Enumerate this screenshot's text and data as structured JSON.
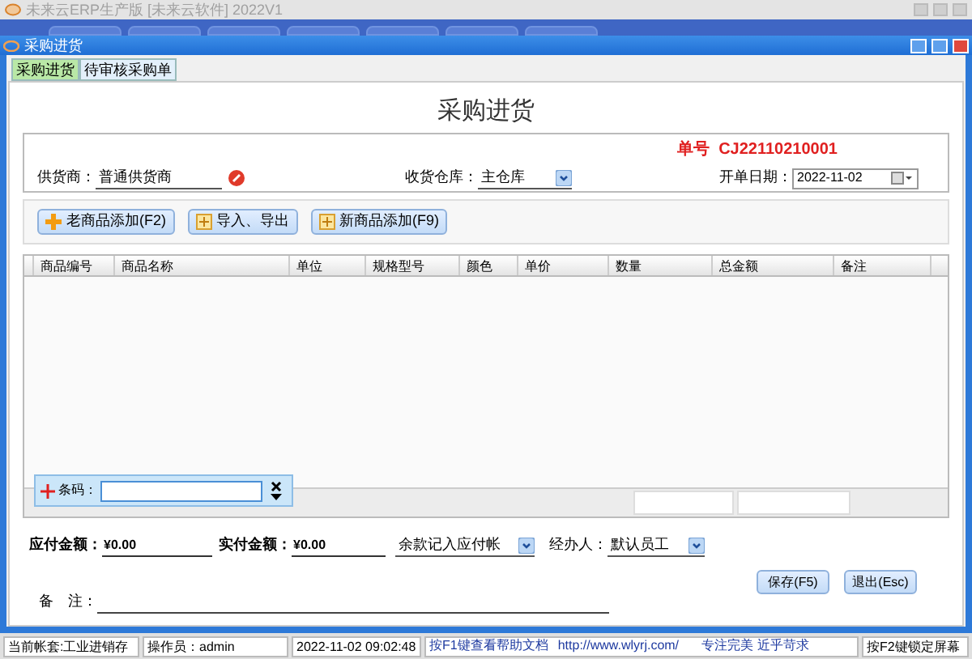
{
  "app_title": "未来云ERP生产版 [未来云软件] 2022V1",
  "window": {
    "title": "采购进货"
  },
  "tabs": [
    {
      "label": "采购进货",
      "selected": true
    },
    {
      "label": "待审核采购单",
      "selected": false
    }
  ],
  "form_title": "采购进货",
  "order_no": {
    "label": "单号",
    "value": "CJ22110210001"
  },
  "supplier": {
    "label": "供货商：",
    "value": "普通供货商"
  },
  "warehouse": {
    "label": "收货仓库：",
    "value": "主仓库"
  },
  "date": {
    "label": "开单日期：",
    "value": "2022-11-02"
  },
  "toolbar": [
    {
      "label": "老商品添加(F2)",
      "kind": "plus"
    },
    {
      "label": "导入、导出",
      "kind": "box"
    },
    {
      "label": "新商品添加(F9)",
      "kind": "box"
    }
  ],
  "table": {
    "columns": [
      "商品编号",
      "商品名称",
      "单位",
      "规格型号",
      "颜色",
      "单价",
      "数量",
      "总金额",
      "备注"
    ]
  },
  "barcode": {
    "label": "条码："
  },
  "payable": {
    "label": "应付金额：",
    "value": "¥0.00"
  },
  "paid": {
    "label": "实付金额：",
    "value": "¥0.00"
  },
  "balance_mode": {
    "value": "余款记入应付帐"
  },
  "handler": {
    "label": "经办人：",
    "value": "默认员工"
  },
  "buttons": [
    "保存(F5)",
    "退出(Esc)"
  ],
  "remark": {
    "label_1": "备",
    "label_2": "注："
  },
  "status_bar": [
    "当前帐套:工业进销存",
    "操作员：admin",
    "2022-11-02 09:02:48",
    "按F1键查看帮助文档",
    "http://www.wlyrj.com/",
    "专注完美 近乎苛求",
    "按F2键锁定屏幕"
  ]
}
